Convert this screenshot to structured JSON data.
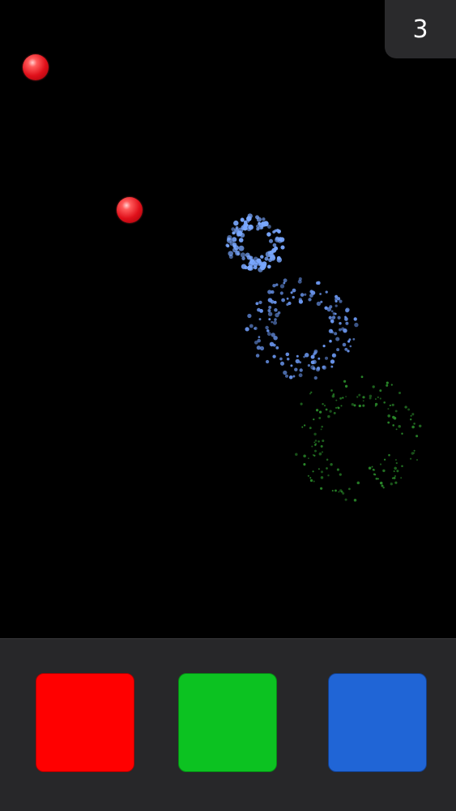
{
  "score": "3",
  "balls": [
    {
      "name": "red-ball-1",
      "color": "#e0101a"
    },
    {
      "name": "red-ball-2",
      "color": "#e0101a"
    }
  ],
  "bursts": [
    {
      "name": "blue-burst-1",
      "color": "#7aa8ff"
    },
    {
      "name": "blue-burst-2",
      "color": "#6a96ee"
    },
    {
      "name": "green-burst",
      "color": "#2a8a2a"
    }
  ],
  "buttons": [
    {
      "name": "red-color-button",
      "color": "#ff0000"
    },
    {
      "name": "green-color-button",
      "color": "#0cc221"
    },
    {
      "name": "blue-color-button",
      "color": "#2065d6"
    }
  ]
}
